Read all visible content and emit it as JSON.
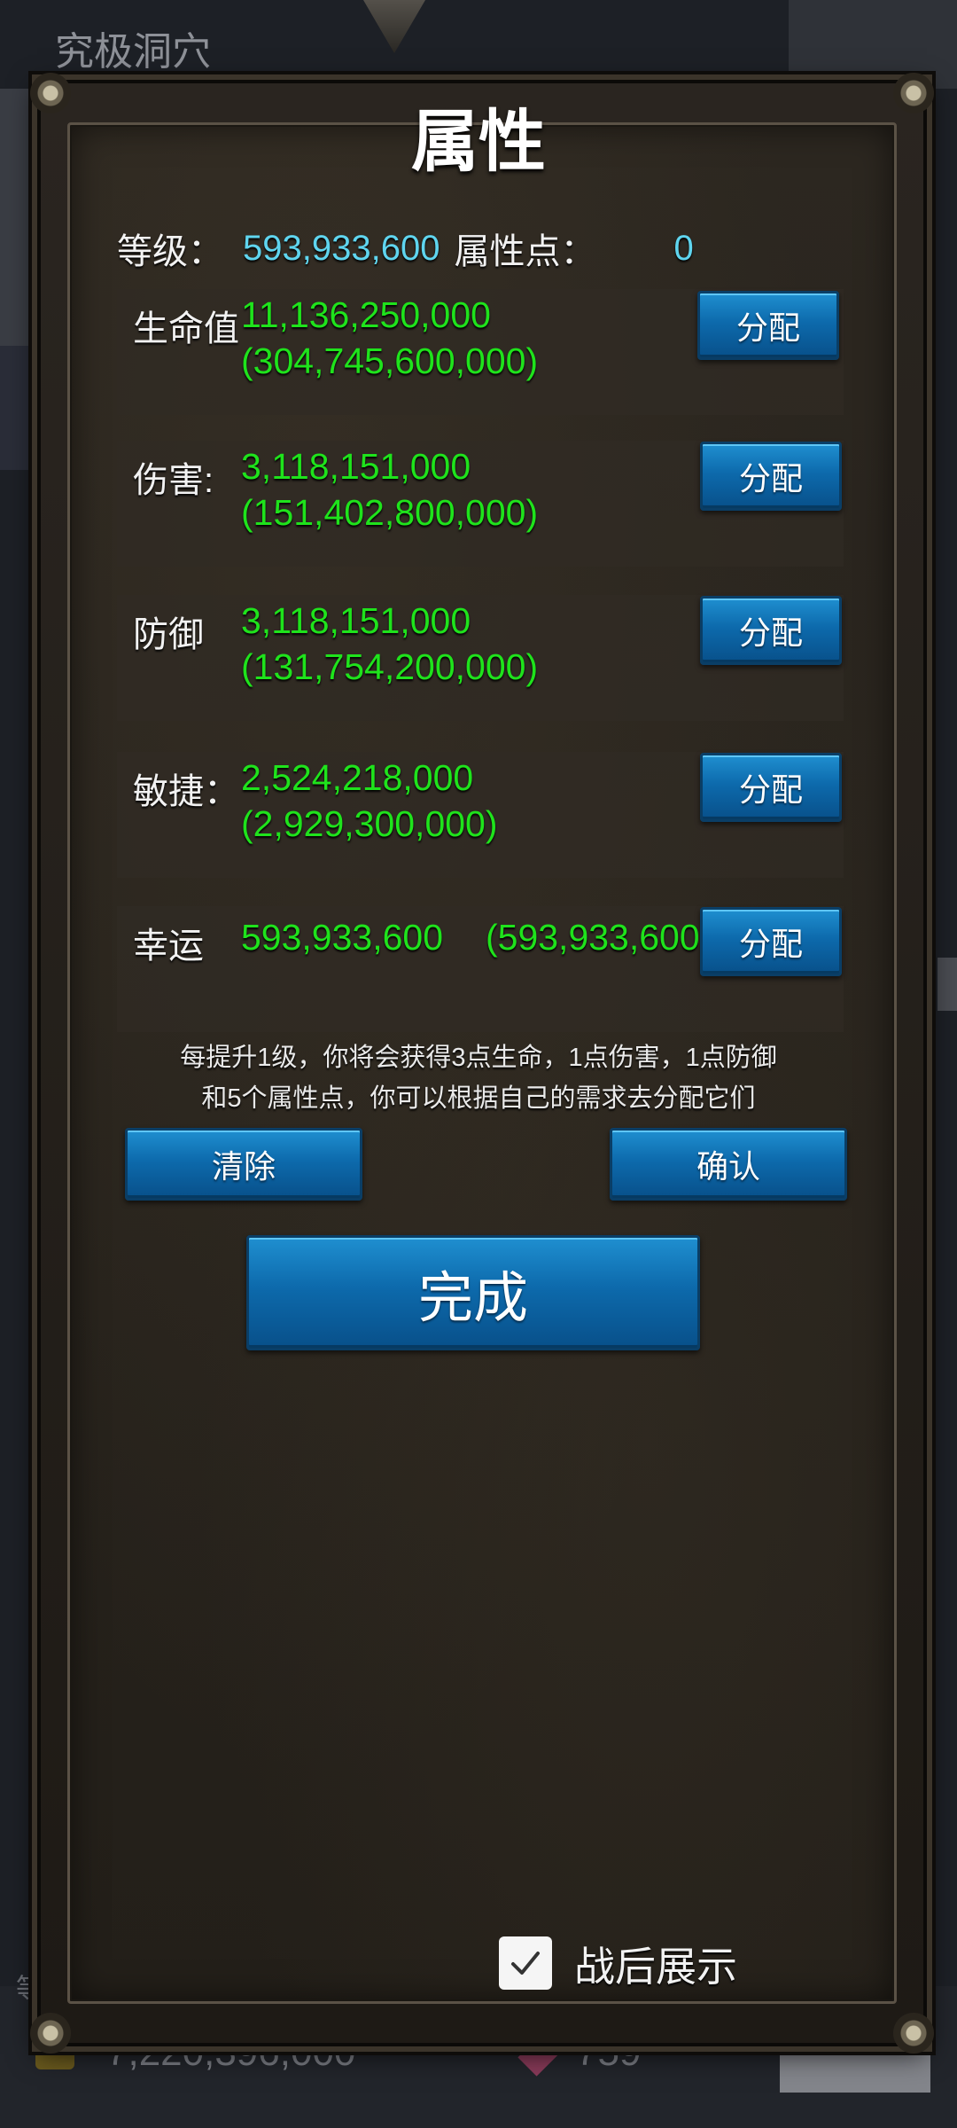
{
  "background": {
    "area_title": "究极洞穴",
    "side_char": "等",
    "gold_amount": "7,220,396,000",
    "gem_count": "759"
  },
  "panel": {
    "title": "属性",
    "level_label": "等级：",
    "level_value": "593,933,600",
    "points_label": "属性点：",
    "points_value": "0",
    "stats": [
      {
        "label": "生命值",
        "value": "11,136,250,000",
        "bonus": "(304,745,600,000)",
        "button": "分配"
      },
      {
        "label": "伤害:",
        "value": "3,118,151,000",
        "bonus": "(151,402,800,000)",
        "button": "分配"
      },
      {
        "label": "防御",
        "value": "3,118,151,000",
        "bonus": "(131,754,200,000)",
        "button": "分配"
      },
      {
        "label": "敏捷：",
        "value": "2,524,218,000",
        "bonus": "(2,929,300,000)",
        "button": "分配"
      },
      {
        "label": "幸运",
        "value": "593,933,600",
        "bonus": "(593,933,600)",
        "button": "分配"
      }
    ],
    "info_line1": "每提升1级，你将会获得3点生命，1点伤害，1点防御",
    "info_line2": "和5个属性点，你可以根据自己的需求去分配它们",
    "clear_button": "清除",
    "confirm_button": "确认",
    "done_button": "完成",
    "show_after_battle_label": "战后展示",
    "show_after_battle_checked": true
  },
  "colors": {
    "stat_value": "#1fe31c",
    "level_value": "#5fd5ef",
    "button_blue": "#0d6aac"
  }
}
